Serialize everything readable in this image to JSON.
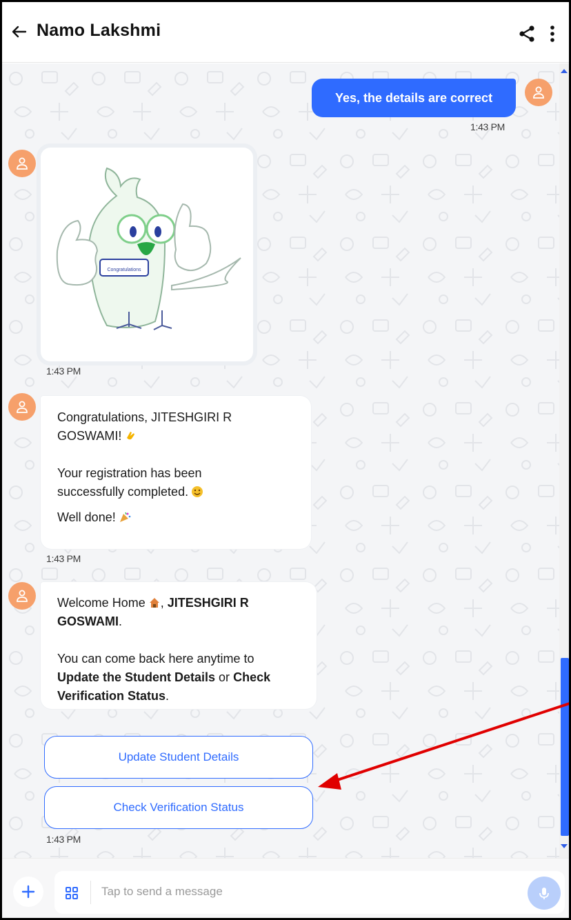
{
  "header": {
    "title": "Namo Lakshmi"
  },
  "messages": {
    "outgoing_text": "Yes, the details are correct",
    "outgoing_time": "1:43 PM",
    "image_badge_text": "Congratulations",
    "image_time": "1:43 PM",
    "congrats_line1": "Congratulations, JITESHGIRI R GOSWAMI!",
    "congrats_line2": "Your registration has been successfully completed.",
    "congrats_line3": "Well done!",
    "congrats_time": "1:43 PM",
    "welcome_prefix": "Welcome Home",
    "welcome_name": "JITESHGIRI R GOSWAMI",
    "welcome_info_prefix": "You can come back here anytime to",
    "welcome_bold1": "Update the Student Details",
    "welcome_or": "or",
    "welcome_bold2": "Check Verification Status",
    "welcome_time": "1:43 PM"
  },
  "buttons": {
    "update": "Update Student Details",
    "check": "Check Verification Status"
  },
  "composer": {
    "placeholder": "Tap to send a message"
  },
  "icons": {
    "back": "arrow-left-icon",
    "share": "share-icon",
    "more": "more-vertical-icon",
    "plus": "plus-icon",
    "grid": "grid-icon",
    "mic": "microphone-icon",
    "avatar": "user-icon"
  },
  "colors": {
    "accent": "#2f6bff",
    "avatar": "#f6a06b",
    "annotation": "#e00000"
  }
}
